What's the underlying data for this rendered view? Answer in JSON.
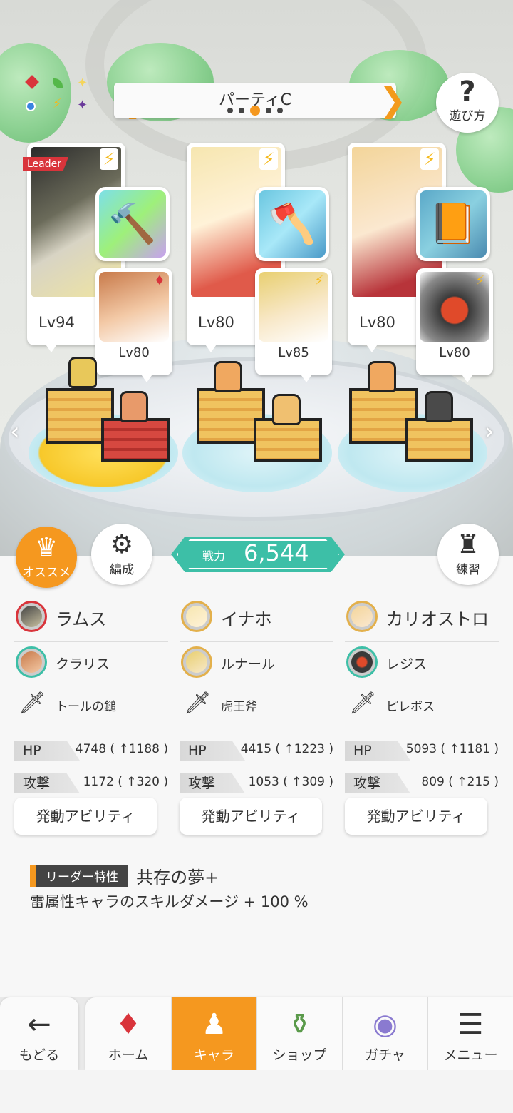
{
  "party": {
    "title": "パーティC",
    "page_count": 5,
    "current_page": 3
  },
  "help": {
    "icon": "?",
    "label": "遊び方"
  },
  "leader_tag": "Leader",
  "slots": [
    {
      "main_level": "Lv94",
      "sub_level": "Lv80",
      "weapon_icon": "hammer",
      "element": "lightning",
      "sub_element": "fire"
    },
    {
      "main_level": "Lv80",
      "sub_level": "Lv85",
      "weapon_icon": "axe",
      "element": "lightning",
      "sub_element": "lightning"
    },
    {
      "main_level": "Lv80",
      "sub_level": "Lv80",
      "weapon_icon": "book",
      "element": "lightning",
      "sub_element": "lightning"
    }
  ],
  "buttons": {
    "recommend": "オススメ",
    "formation": "編成",
    "training": "練習"
  },
  "power": {
    "label": "戦力",
    "value": "6,544"
  },
  "members": [
    {
      "main_name": "ラムス",
      "sub_name": "クラリス",
      "weapon": "トールの鎚",
      "hp_label": "HP",
      "hp_value": "4748 ( ↑1188 )",
      "atk_label": "攻撃",
      "atk_value": "1172 ( ↑320 )",
      "ability": "発動アビリティ"
    },
    {
      "main_name": "イナホ",
      "sub_name": "ルナール",
      "weapon": "虎王斧",
      "hp_label": "HP",
      "hp_value": "4415 ( ↑1223 )",
      "atk_label": "攻撃",
      "atk_value": "1053 ( ↑309 )",
      "ability": "発動アビリティ"
    },
    {
      "main_name": "カリオストロ",
      "sub_name": "レジス",
      "weapon": "ピレボス",
      "hp_label": "HP",
      "hp_value": "5093 ( ↑1181 )",
      "atk_label": "攻撃",
      "atk_value": "809 ( ↑215 )",
      "ability": "発動アビリティ"
    }
  ],
  "leader_skill": {
    "tag": "リーダー特性",
    "name": "共存の夢+",
    "description": "雷属性キャラのスキルダメージ + 100 %"
  },
  "nav": {
    "back": "もどる",
    "home": "ホーム",
    "chara": "キャラ",
    "shop": "ショップ",
    "gacha": "ガチャ",
    "menu": "メニュー"
  },
  "colors": {
    "accent": "#f5981f",
    "teal": "#3dbfa7",
    "leader_red": "#d9343b"
  }
}
